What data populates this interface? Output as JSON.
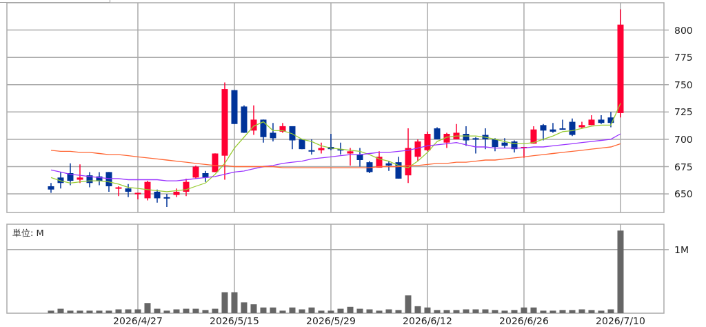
{
  "price_chart": {
    "chart_data": {
      "type": "candlestick",
      "grid": true,
      "categories": [
        null,
        null,
        null,
        null,
        null,
        null,
        null,
        null,
        null,
        null,
        null,
        null,
        null,
        null,
        null,
        null,
        null,
        null,
        null,
        null,
        null,
        null,
        null,
        null,
        null,
        null,
        null,
        null,
        null,
        null,
        null,
        null,
        null,
        null,
        null,
        null,
        null,
        null,
        null,
        null,
        null,
        null,
        null,
        null,
        null,
        null,
        null,
        null,
        null,
        null,
        null,
        null,
        null,
        null,
        null,
        null,
        null,
        null,
        null,
        null
      ],
      "ylim": [
        633,
        825
      ],
      "yticks": [
        {
          "value": 650,
          "label": "650"
        },
        {
          "value": 675,
          "label": "675"
        },
        {
          "value": 700,
          "label": "700"
        },
        {
          "value": 725,
          "label": "725"
        },
        {
          "value": 750,
          "label": "750"
        },
        {
          "value": 775,
          "label": "775"
        },
        {
          "value": 800,
          "label": "800"
        }
      ],
      "ohlc": [
        [
          657,
          660,
          651,
          654
        ],
        [
          665,
          670,
          655,
          660
        ],
        [
          669,
          678,
          658,
          662
        ],
        [
          663,
          677,
          660,
          665
        ],
        [
          667,
          670,
          656,
          660
        ],
        [
          666,
          670,
          658,
          662
        ],
        [
          670,
          670,
          652,
          657
        ],
        [
          655,
          657,
          648,
          656
        ],
        [
          655,
          659,
          647,
          652
        ],
        [
          650,
          651,
          645,
          651
        ],
        [
          646,
          662,
          644,
          661
        ],
        [
          652,
          654,
          642,
          646
        ],
        [
          647,
          650,
          638,
          646
        ],
        [
          649,
          655,
          647,
          652
        ],
        [
          652,
          664,
          648,
          661
        ],
        [
          665,
          676,
          664,
          675
        ],
        [
          669,
          671,
          661,
          665
        ],
        [
          670,
          687,
          670,
          687
        ],
        [
          685,
          752,
          663,
          746
        ],
        [
          745,
          745,
          714,
          714
        ],
        [
          730,
          731,
          706,
          706
        ],
        [
          708,
          731,
          704,
          718
        ],
        [
          718,
          718,
          697,
          702
        ],
        [
          706,
          715,
          698,
          701
        ],
        [
          707,
          715,
          706,
          712
        ],
        [
          712,
          712,
          691,
          699
        ],
        [
          700,
          700,
          691,
          691
        ],
        [
          690,
          700,
          686,
          689
        ],
        [
          690,
          697,
          687,
          692
        ],
        [
          693,
          705,
          690,
          691
        ],
        [
          691,
          697,
          686,
          690
        ],
        [
          687,
          692,
          676,
          689
        ],
        [
          686,
          692,
          675,
          681
        ],
        [
          679,
          680,
          669,
          670
        ],
        [
          674,
          689,
          674,
          684
        ],
        [
          678,
          680,
          671,
          676
        ],
        [
          679,
          684,
          664,
          664
        ],
        [
          667,
          710,
          660,
          692
        ],
        [
          684,
          700,
          680,
          698
        ],
        [
          690,
          707,
          689,
          705
        ],
        [
          710,
          711,
          700,
          700
        ],
        [
          697,
          706,
          692,
          705
        ],
        [
          700,
          714,
          700,
          706
        ],
        [
          705,
          712,
          694,
          699
        ],
        [
          701,
          702,
          687,
          700
        ],
        [
          704,
          710,
          691,
          700
        ],
        [
          700,
          701,
          689,
          693
        ],
        [
          697,
          701,
          692,
          694
        ],
        [
          698,
          699,
          688,
          691
        ],
        [
          692,
          693,
          683,
          693
        ],
        [
          696,
          712,
          696,
          709
        ],
        [
          713,
          714,
          699,
          708
        ],
        [
          709,
          715,
          706,
          707
        ],
        [
          710,
          718,
          709,
          709
        ],
        [
          716,
          719,
          703,
          704
        ],
        [
          711,
          716,
          710,
          713
        ],
        [
          713,
          722,
          713,
          718
        ],
        [
          718,
          722,
          714,
          715
        ],
        [
          720,
          725,
          711,
          715
        ],
        [
          724,
          819,
          720,
          805
        ]
      ],
      "series": [
        {
          "type": "line",
          "color": "#99cc33",
          "values": [
            665,
            662,
            660,
            661,
            662,
            662,
            661,
            659,
            656,
            655,
            654,
            653,
            652,
            653,
            654,
            657,
            660,
            668,
            678,
            692,
            702,
            712,
            716,
            708,
            708,
            705,
            700,
            698,
            694,
            692,
            691,
            690,
            689,
            686,
            682,
            680,
            676,
            674,
            680,
            688,
            698,
            702,
            703,
            703,
            703,
            702,
            700,
            698,
            696,
            696,
            697,
            700,
            703,
            707,
            708,
            710,
            712,
            713,
            713,
            733
          ]
        },
        {
          "type": "line",
          "color": "#9933ff",
          "values": [
            672,
            670,
            668,
            667,
            666,
            665,
            664,
            664,
            663,
            663,
            663,
            663,
            662,
            662,
            663,
            664,
            665,
            666,
            668,
            670,
            671,
            673,
            675,
            676,
            678,
            679,
            680,
            682,
            683,
            684,
            685,
            686,
            686,
            687,
            688,
            688,
            689,
            690,
            692,
            694,
            695,
            696,
            697,
            695,
            693,
            693,
            692,
            692,
            692,
            692,
            693,
            693,
            694,
            695,
            696,
            697,
            698,
            699,
            700,
            705
          ]
        },
        {
          "type": "line",
          "color": "#ff6633",
          "values": [
            690,
            689,
            689,
            688,
            688,
            687,
            686,
            686,
            685,
            684,
            683,
            682,
            681,
            680,
            679,
            678,
            677,
            676,
            676,
            675,
            675,
            675,
            675,
            675,
            674,
            674,
            674,
            674,
            674,
            674,
            674,
            674,
            674,
            674,
            675,
            675,
            675,
            676,
            676,
            677,
            678,
            678,
            679,
            679,
            680,
            681,
            681,
            682,
            683,
            684,
            685,
            686,
            687,
            688,
            689,
            690,
            691,
            692,
            693,
            696
          ]
        }
      ]
    }
  },
  "volume_chart": {
    "unit_label": "単位: M",
    "chart_data": {
      "type": "bar",
      "grid": true,
      "ylim": [
        0,
        1.4
      ],
      "categories": [
        null,
        null,
        null,
        null,
        null,
        null,
        null,
        null,
        null,
        "2026/4/27",
        null,
        null,
        null,
        null,
        null,
        null,
        null,
        null,
        null,
        "2026/5/15",
        null,
        null,
        null,
        null,
        null,
        null,
        null,
        null,
        null,
        "2026/5/29",
        null,
        null,
        null,
        null,
        null,
        null,
        null,
        null,
        null,
        "2026/6/12",
        null,
        null,
        null,
        null,
        null,
        null,
        null,
        null,
        null,
        "2026/6/26",
        null,
        null,
        null,
        null,
        null,
        null,
        null,
        null,
        null,
        "2026/7/10"
      ],
      "yticks": [
        {
          "value": 1,
          "label": "1M"
        }
      ],
      "series": [
        {
          "color": "#666666",
          "values": [
            0.04,
            0.07,
            0.04,
            0.04,
            0.04,
            0.04,
            0.04,
            0.06,
            0.06,
            0.06,
            0.16,
            0.07,
            0.04,
            0.06,
            0.07,
            0.07,
            0.05,
            0.07,
            0.33,
            0.33,
            0.17,
            0.14,
            0.09,
            0.09,
            0.04,
            0.09,
            0.06,
            0.09,
            0.04,
            0.04,
            0.07,
            0.1,
            0.07,
            0.06,
            0.04,
            0.06,
            0.05,
            0.28,
            0.11,
            0.09,
            0.05,
            0.05,
            0.05,
            0.06,
            0.06,
            0.06,
            0.05,
            0.04,
            0.05,
            0.09,
            0.09,
            0.04,
            0.04,
            0.05,
            0.05,
            0.06,
            0.05,
            0.04,
            0.06,
            1.3
          ]
        }
      ]
    }
  }
}
